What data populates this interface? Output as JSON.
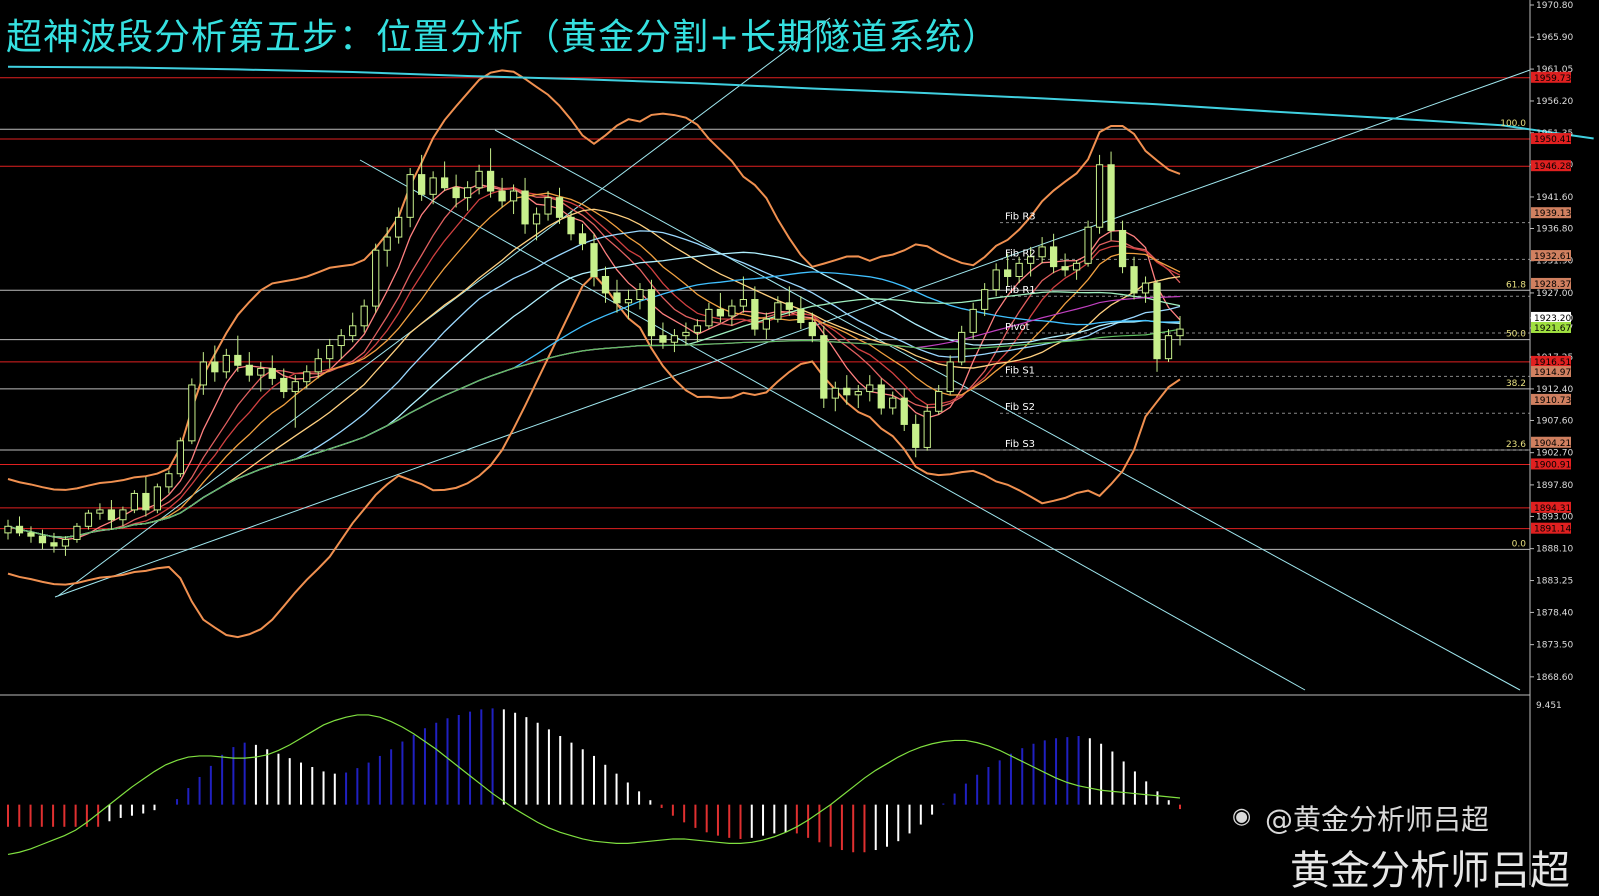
{
  "title": "超神波段分析第五步：位置分析（黄金分割+长期隧道系统）",
  "watermark": {
    "handle": "@黄金分析师吕超",
    "name": "黄金分析师吕超",
    "icon": "weibo-icon"
  },
  "colors": {
    "background": "#000000",
    "candle_up": "#c8f08c",
    "candle_down": "#c8f08c",
    "tunnel": "#40d0e0",
    "bollinger": "#f09050",
    "red_line": "#e02020",
    "fib_line": "#ffffff",
    "macd_up": "#2020c0",
    "macd_down": "#e03030",
    "macd_neutral": "#ffffff",
    "signal": "#80e040"
  },
  "chart_data": [
    {
      "type": "candlestick",
      "symbol_panel": "main",
      "ylim": [
        1866.6,
        1970.8
      ],
      "price_ticks": [
        "1970.80",
        "1965.90",
        "1961.05",
        "1956.20",
        "1951.35",
        "1946.50",
        "1941.60",
        "1936.80",
        "1931.90",
        "1927.00",
        "1923.20",
        "1921.67",
        "1917.25",
        "1912.40",
        "1907.60",
        "1902.70",
        "1897.80",
        "1893.00",
        "1888.10",
        "1883.25",
        "1878.40",
        "1873.50",
        "1868.60"
      ],
      "right_labels": [
        {
          "text": "1959.73",
          "price": 1959.73,
          "color": "#e02020"
        },
        {
          "text": "1950.41",
          "price": 1950.41,
          "color": "#e02020"
        },
        {
          "text": "1946.28",
          "price": 1946.28,
          "color": "#e02020"
        },
        {
          "text": "1939.13",
          "price": 1939.13,
          "color": "#d08060"
        },
        {
          "text": "1932.61",
          "price": 1932.61,
          "color": "#d08060"
        },
        {
          "text": "1928.37",
          "price": 1928.37,
          "color": "#d08060"
        },
        {
          "text": "1923.20",
          "price": 1923.2,
          "color": "#ffffff"
        },
        {
          "text": "1921.67",
          "price": 1921.67,
          "color": "#a0e040"
        },
        {
          "text": "1916.51",
          "price": 1916.51,
          "color": "#e02020"
        },
        {
          "text": "1914.97",
          "price": 1914.97,
          "color": "#d08060"
        },
        {
          "text": "1910.73",
          "price": 1910.73,
          "color": "#d08060"
        },
        {
          "text": "1904.21",
          "price": 1904.21,
          "color": "#d08060"
        },
        {
          "text": "1900.91",
          "price": 1900.91,
          "color": "#e02020"
        },
        {
          "text": "1894.31",
          "price": 1894.31,
          "color": "#e02020"
        },
        {
          "text": "1891.14",
          "price": 1891.14,
          "color": "#e02020"
        }
      ],
      "fib_levels": [
        {
          "label": "100.0",
          "price": 1951.9
        },
        {
          "label": "61.8",
          "price": 1927.4
        },
        {
          "label": "50.0",
          "price": 1919.9
        },
        {
          "label": "38.2",
          "price": 1912.4
        },
        {
          "label": "23.6",
          "price": 1903.1
        },
        {
          "label": "0.0",
          "price": 1888.0
        }
      ],
      "pivot_labels": [
        {
          "text": "Fib R3",
          "price": 1937.7
        },
        {
          "text": "Fib R2",
          "price": 1932.1
        },
        {
          "text": "Fib R1",
          "price": 1926.5
        },
        {
          "text": "Pivot",
          "price": 1920.9
        },
        {
          "text": "Fib S1",
          "price": 1914.3
        },
        {
          "text": "Fib S2",
          "price": 1908.7
        },
        {
          "text": "Fib S3",
          "price": 1903.1
        }
      ],
      "red_lines": [
        1959.73,
        1950.41,
        1946.28,
        1916.51,
        1900.91,
        1894.31,
        1891.14
      ],
      "tunnel_line": [
        [
          0,
          1961.4
        ],
        [
          10,
          1961.3
        ],
        [
          20,
          1961.0
        ],
        [
          30,
          1960.6
        ],
        [
          40,
          1960.0
        ],
        [
          50,
          1959.5
        ],
        [
          60,
          1958.9
        ],
        [
          70,
          1958.1
        ],
        [
          80,
          1957.4
        ],
        [
          90,
          1956.6
        ],
        [
          100,
          1955.7
        ],
        [
          110,
          1954.6
        ],
        [
          120,
          1953.6
        ],
        [
          130,
          1952.5
        ],
        [
          138,
          1950.5
        ]
      ],
      "candles": [
        [
          1890.5,
          1892.5,
          1889.5,
          1891.5
        ],
        [
          1891.5,
          1893.0,
          1890.0,
          1890.5
        ],
        [
          1890.5,
          1891.5,
          1889.0,
          1890.0
        ],
        [
          1890.0,
          1891.0,
          1888.0,
          1889.0
        ],
        [
          1889.0,
          1890.5,
          1887.5,
          1888.5
        ],
        [
          1888.5,
          1890.0,
          1887.0,
          1889.5
        ],
        [
          1889.5,
          1892.0,
          1889.0,
          1891.5
        ],
        [
          1891.5,
          1894.0,
          1891.0,
          1893.5
        ],
        [
          1893.5,
          1895.0,
          1892.5,
          1894.0
        ],
        [
          1894.0,
          1895.5,
          1891.0,
          1892.5
        ],
        [
          1892.5,
          1894.5,
          1891.5,
          1894.0
        ],
        [
          1894.0,
          1897.0,
          1893.5,
          1896.5
        ],
        [
          1896.5,
          1899.0,
          1893.0,
          1894.0
        ],
        [
          1894.0,
          1898.0,
          1893.5,
          1897.5
        ],
        [
          1897.5,
          1900.0,
          1896.5,
          1899.5
        ],
        [
          1899.5,
          1905.0,
          1899.0,
          1904.5
        ],
        [
          1904.5,
          1914.0,
          1904.0,
          1913.0
        ],
        [
          1913.0,
          1918.0,
          1911.5,
          1916.5
        ],
        [
          1916.5,
          1919.0,
          1913.5,
          1915.0
        ],
        [
          1915.0,
          1918.5,
          1914.0,
          1917.5
        ],
        [
          1917.5,
          1920.5,
          1915.0,
          1916.0
        ],
        [
          1916.0,
          1918.0,
          1913.5,
          1914.5
        ],
        [
          1914.5,
          1916.5,
          1912.0,
          1915.5
        ],
        [
          1915.5,
          1917.5,
          1913.0,
          1914.0
        ],
        [
          1914.0,
          1915.5,
          1911.0,
          1912.0
        ],
        [
          1912.0,
          1914.5,
          1906.5,
          1913.5
        ],
        [
          1913.5,
          1916.0,
          1912.5,
          1915.0
        ],
        [
          1915.0,
          1918.5,
          1914.0,
          1917.0
        ],
        [
          1917.0,
          1920.0,
          1915.5,
          1919.0
        ],
        [
          1919.0,
          1921.5,
          1917.0,
          1920.5
        ],
        [
          1920.5,
          1924.0,
          1919.5,
          1922.0
        ],
        [
          1922.0,
          1926.0,
          1921.0,
          1925.0
        ],
        [
          1925.0,
          1934.5,
          1924.0,
          1933.5
        ],
        [
          1933.5,
          1937.0,
          1931.0,
          1935.5
        ],
        [
          1935.5,
          1940.0,
          1934.5,
          1938.5
        ],
        [
          1938.5,
          1946.0,
          1937.0,
          1945.0
        ],
        [
          1945.0,
          1948.0,
          1941.0,
          1942.0
        ],
        [
          1942.0,
          1945.5,
          1940.5,
          1944.5
        ],
        [
          1944.5,
          1947.0,
          1942.5,
          1943.0
        ],
        [
          1943.0,
          1945.0,
          1940.0,
          1941.5
        ],
        [
          1941.5,
          1944.0,
          1939.5,
          1943.0
        ],
        [
          1943.0,
          1946.5,
          1942.0,
          1945.5
        ],
        [
          1945.5,
          1949.0,
          1941.5,
          1942.5
        ],
        [
          1942.5,
          1944.5,
          1940.0,
          1941.0
        ],
        [
          1941.0,
          1943.5,
          1939.0,
          1942.5
        ],
        [
          1942.5,
          1944.5,
          1936.0,
          1937.5
        ],
        [
          1937.5,
          1940.0,
          1935.0,
          1939.0
        ],
        [
          1939.0,
          1942.5,
          1938.0,
          1941.5
        ],
        [
          1941.5,
          1943.0,
          1937.5,
          1938.5
        ],
        [
          1938.5,
          1939.5,
          1935.0,
          1936.0
        ],
        [
          1936.0,
          1937.5,
          1933.5,
          1934.5
        ],
        [
          1934.5,
          1936.0,
          1928.0,
          1929.5
        ],
        [
          1929.5,
          1931.0,
          1925.5,
          1927.0
        ],
        [
          1927.0,
          1929.0,
          1924.0,
          1925.5
        ],
        [
          1925.5,
          1927.5,
          1923.0,
          1926.0
        ],
        [
          1926.0,
          1928.5,
          1924.5,
          1927.5
        ],
        [
          1927.5,
          1929.0,
          1919.0,
          1920.5
        ],
        [
          1920.5,
          1922.5,
          1918.5,
          1919.5
        ],
        [
          1919.5,
          1921.5,
          1918.0,
          1920.5
        ],
        [
          1920.5,
          1922.5,
          1919.0,
          1921.0
        ],
        [
          1921.0,
          1923.0,
          1919.5,
          1922.0
        ],
        [
          1922.0,
          1925.5,
          1921.5,
          1924.5
        ],
        [
          1924.5,
          1927.0,
          1922.5,
          1923.5
        ],
        [
          1923.5,
          1926.0,
          1922.0,
          1925.0
        ],
        [
          1925.0,
          1929.5,
          1924.0,
          1926.0
        ],
        [
          1926.0,
          1928.0,
          1920.5,
          1921.5
        ],
        [
          1921.5,
          1924.0,
          1920.0,
          1923.0
        ],
        [
          1923.0,
          1926.5,
          1922.5,
          1925.5
        ],
        [
          1925.5,
          1928.0,
          1923.5,
          1924.5
        ],
        [
          1924.5,
          1926.5,
          1921.5,
          1922.5
        ],
        [
          1922.5,
          1924.0,
          1919.5,
          1920.5
        ],
        [
          1920.5,
          1922.0,
          1909.5,
          1911.0
        ],
        [
          1911.0,
          1913.5,
          1909.0,
          1912.5
        ],
        [
          1912.5,
          1914.5,
          1910.0,
          1911.5
        ],
        [
          1911.5,
          1913.0,
          1909.5,
          1912.0
        ],
        [
          1912.0,
          1914.5,
          1910.5,
          1913.0
        ],
        [
          1913.0,
          1914.0,
          1908.5,
          1909.5
        ],
        [
          1909.5,
          1912.0,
          1908.5,
          1911.0
        ],
        [
          1911.0,
          1912.5,
          1906.0,
          1907.0
        ],
        [
          1907.0,
          1908.5,
          1902.0,
          1903.5
        ],
        [
          1903.5,
          1910.0,
          1903.0,
          1909.0
        ],
        [
          1909.0,
          1913.0,
          1908.5,
          1912.0
        ],
        [
          1912.0,
          1917.5,
          1911.5,
          1916.5
        ],
        [
          1916.5,
          1922.0,
          1916.0,
          1921.0
        ],
        [
          1921.0,
          1925.5,
          1920.0,
          1924.5
        ],
        [
          1924.5,
          1928.5,
          1923.5,
          1927.5
        ],
        [
          1927.5,
          1931.5,
          1926.5,
          1930.5
        ],
        [
          1930.5,
          1933.0,
          1928.0,
          1929.5
        ],
        [
          1929.5,
          1932.5,
          1928.5,
          1931.5
        ],
        [
          1931.5,
          1934.0,
          1929.5,
          1932.5
        ],
        [
          1932.5,
          1935.5,
          1931.5,
          1934.0
        ],
        [
          1934.0,
          1936.0,
          1930.0,
          1931.0
        ],
        [
          1931.0,
          1933.0,
          1929.5,
          1930.5
        ],
        [
          1930.5,
          1932.0,
          1929.0,
          1931.5
        ],
        [
          1931.5,
          1938.0,
          1931.0,
          1937.0
        ],
        [
          1937.0,
          1948.0,
          1936.0,
          1946.5
        ],
        [
          1946.5,
          1948.5,
          1935.0,
          1936.5
        ],
        [
          1936.5,
          1938.0,
          1930.0,
          1931.0
        ],
        [
          1931.0,
          1932.5,
          1926.0,
          1927.0
        ],
        [
          1927.0,
          1929.5,
          1925.5,
          1928.5
        ],
        [
          1928.5,
          1929.0,
          1915.0,
          1917.0
        ],
        [
          1917.0,
          1921.5,
          1916.5,
          1920.5
        ],
        [
          1920.5,
          1923.5,
          1919.0,
          1921.5
        ]
      ]
    },
    {
      "type": "bar",
      "panel": "macd",
      "ylim_top_label": "9.451",
      "histogram": [
        -2,
        -2,
        -2,
        -2,
        -2,
        -2,
        -2,
        -2,
        -2,
        -1.5,
        -1.2,
        -1,
        -0.8,
        -0.5,
        0,
        0.5,
        1.5,
        2.5,
        3.5,
        4.5,
        5.2,
        5.6,
        5.4,
        5.0,
        4.6,
        4.2,
        3.8,
        3.4,
        3.0,
        2.8,
        2.9,
        3.3,
        3.8,
        4.4,
        5.0,
        5.7,
        6.3,
        6.9,
        7.4,
        7.8,
        8.1,
        8.4,
        8.6,
        8.7,
        8.6,
        8.3,
        7.9,
        7.4,
        6.8,
        6.2,
        5.6,
        5.0,
        4.4,
        3.6,
        2.8,
        2.0,
        1.2,
        0.4,
        -0.3,
        -1.0,
        -1.6,
        -2.1,
        -2.5,
        -2.8,
        -3.0,
        -3.1,
        -3.0,
        -2.8,
        -2.6,
        -2.5,
        -2.6,
        -3.0,
        -3.4,
        -3.8,
        -4.1,
        -4.3,
        -4.3,
        -4.1,
        -3.8,
        -3.3,
        -2.6,
        -1.8,
        -0.9,
        0.1,
        1.0,
        1.9,
        2.7,
        3.4,
        4.0,
        4.6,
        5.1,
        5.5,
        5.8,
        6.0,
        6.1,
        6.2,
        6.0,
        5.5,
        4.8,
        3.9,
        3.0,
        2.1,
        1.2,
        0.4,
        -0.4
      ],
      "signal": [
        -4.5,
        -4.3,
        -4.0,
        -3.6,
        -3.2,
        -2.8,
        -2.3,
        -1.6,
        -0.8,
        0.0,
        0.8,
        1.6,
        2.3,
        3.0,
        3.6,
        4.0,
        4.3,
        4.4,
        4.4,
        4.3,
        4.2,
        4.2,
        4.3,
        4.5,
        4.9,
        5.4,
        6.0,
        6.6,
        7.2,
        7.6,
        7.9,
        8.1,
        8.1,
        7.9,
        7.5,
        7.0,
        6.4,
        5.7,
        5.0,
        4.2,
        3.4,
        2.6,
        1.8,
        1.0,
        0.3,
        -0.4,
        -1.0,
        -1.6,
        -2.1,
        -2.5,
        -2.8,
        -3.1,
        -3.3,
        -3.4,
        -3.5,
        -3.5,
        -3.4,
        -3.3,
        -3.2,
        -3.1,
        -3.1,
        -3.2,
        -3.3,
        -3.4,
        -3.5,
        -3.5,
        -3.4,
        -3.2,
        -2.9,
        -2.5,
        -2.0,
        -1.4,
        -0.7,
        0.0,
        0.8,
        1.6,
        2.4,
        3.1,
        3.7,
        4.3,
        4.8,
        5.2,
        5.5,
        5.7,
        5.8,
        5.8,
        5.6,
        5.3,
        4.9,
        4.4,
        3.9,
        3.4,
        2.9,
        2.4,
        2.0,
        1.7,
        1.5,
        1.3,
        1.2,
        1.1,
        1.0,
        0.9,
        0.8,
        0.7,
        0.6
      ]
    }
  ]
}
